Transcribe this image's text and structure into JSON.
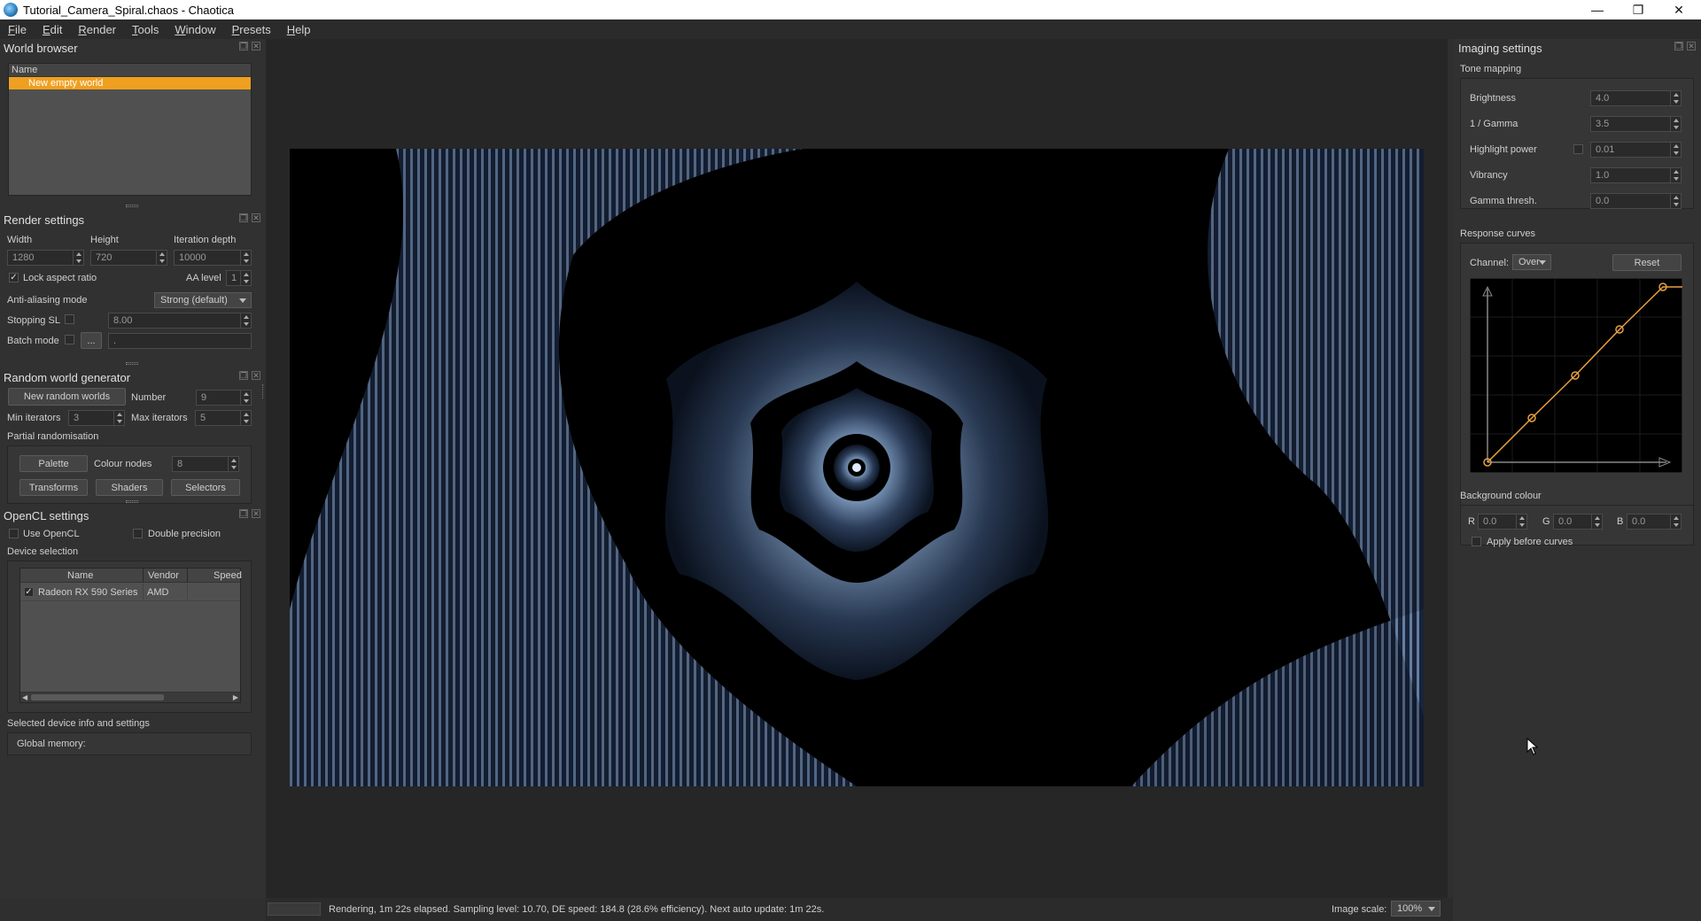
{
  "window": {
    "title": "Tutorial_Camera_Spiral.chaos - Chaotica",
    "minimize": "—",
    "maximize": "❐",
    "close": "✕"
  },
  "menu": [
    "File",
    "Edit",
    "Render",
    "Tools",
    "Window",
    "Presets",
    "Help"
  ],
  "world_browser": {
    "title": "World browser",
    "column_name": "Name",
    "items": [
      "New empty world"
    ]
  },
  "render_settings": {
    "title": "Render settings",
    "width_label": "Width",
    "height_label": "Height",
    "iter_depth_label": "Iteration depth",
    "width": "1280",
    "height": "720",
    "iter_depth": "10000",
    "lock_aspect": "Lock aspect ratio",
    "aa_level_label": "AA level",
    "aa_level": "1",
    "aa_mode_label": "Anti-aliasing mode",
    "aa_mode": "Strong (default)",
    "stopping_sl_label": "Stopping SL",
    "stopping_sl": "8.00",
    "batch_mode_label": "Batch mode",
    "batch_browse": "...",
    "batch_path": "."
  },
  "random_world": {
    "title": "Random world generator",
    "new_button": "New random worlds",
    "number_label": "Number",
    "number": "9",
    "min_label": "Min iterators",
    "min": "3",
    "max_label": "Max iterators",
    "max": "5",
    "partial_label": "Partial randomisation",
    "palette": "Palette",
    "colour_nodes_label": "Colour nodes",
    "colour_nodes": "8",
    "transforms": "Transforms",
    "shaders": "Shaders",
    "selectors": "Selectors"
  },
  "opencl": {
    "title": "OpenCL settings",
    "use_opencl": "Use OpenCL",
    "double_precision": "Double precision",
    "device_selection": "Device selection",
    "columns": [
      "Name",
      "Vendor",
      "Speed"
    ],
    "devices": [
      {
        "name": "Radeon RX 590 Series",
        "vendor": "AMD",
        "speed": ""
      }
    ],
    "selected_info": "Selected device info and settings",
    "global_memory": "Global memory:"
  },
  "imaging": {
    "title": "Imaging settings",
    "tone_mapping": "Tone mapping",
    "brightness_label": "Brightness",
    "brightness": "4.0",
    "gamma_label": "1 / Gamma",
    "gamma": "3.5",
    "highlight_label": "Highlight power",
    "highlight": "0.01",
    "vibrancy_label": "Vibrancy",
    "vibrancy": "1.0",
    "gamma_thresh_label": "Gamma thresh.",
    "gamma_thresh": "0.0",
    "response_curves": "Response curves",
    "channel_label": "Channel:",
    "channel": "Over",
    "reset": "Reset",
    "background_colour": "Background colour",
    "r_label": "R",
    "r": "0.0",
    "g_label": "G",
    "g": "0.0",
    "b_label": "B",
    "b": "0.0",
    "apply_before": "Apply before curves"
  },
  "status": {
    "text": "Rendering, 1m 22s elapsed. Sampling level: 10.70, DE speed: 184.8 (28.6% efficiency). Next auto update: 1m 22s.",
    "image_scale_label": "Image scale:",
    "image_scale": "100%"
  },
  "colors": {
    "accent": "#f0a020",
    "curve": "#e8a040"
  }
}
